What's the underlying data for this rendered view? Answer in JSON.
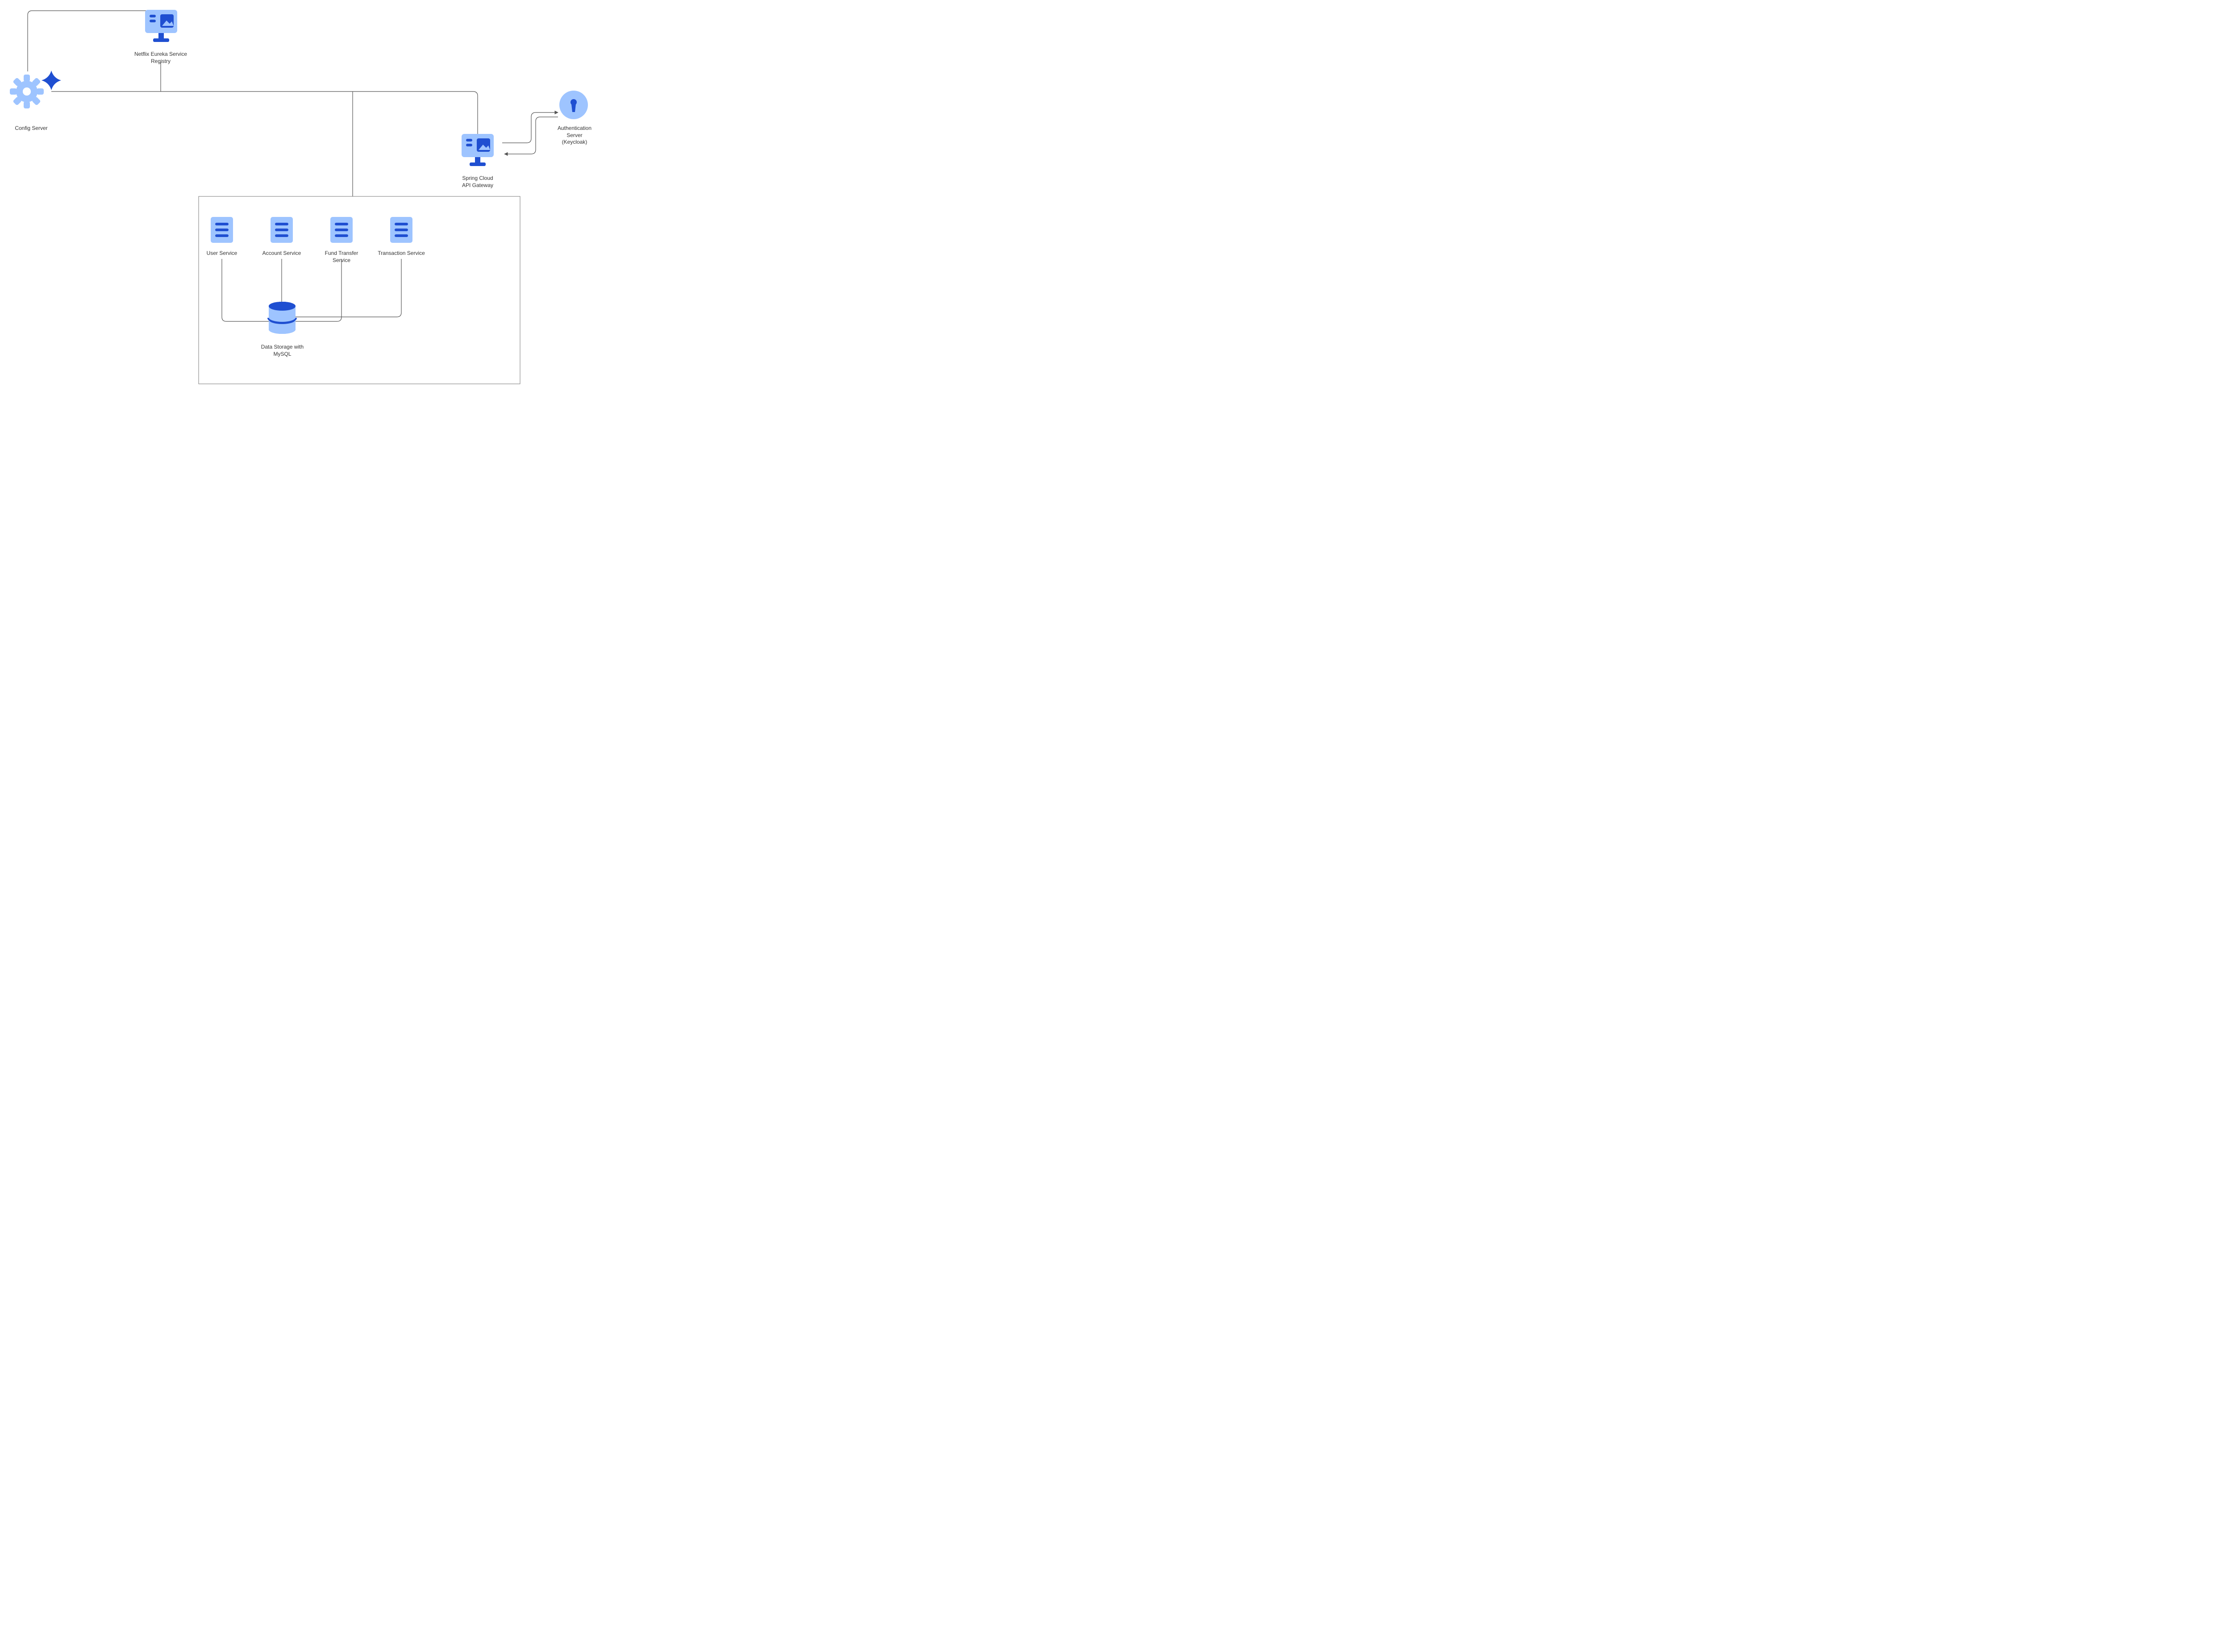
{
  "diagram": {
    "nodes": {
      "config_server": {
        "label": "Config Server"
      },
      "eureka": {
        "label": "Netflix Eureka Service Registry"
      },
      "api_gateway": {
        "label": "Spring Cloud\nAPI Gateway"
      },
      "auth_server": {
        "label": "Authentication\nServer\n(Keycloak)"
      },
      "user_service": {
        "label": "User Service"
      },
      "account_service": {
        "label": "Account Service"
      },
      "fund_transfer_service": {
        "label": "Fund Transfer\nService"
      },
      "transaction_service": {
        "label": "Transaction Service"
      },
      "data_storage": {
        "label": "Data Storage with\nMySQL"
      }
    },
    "colors": {
      "light_blue": "#9ec4ff",
      "dark_blue": "#1f4fd1",
      "stroke": "#555"
    }
  }
}
